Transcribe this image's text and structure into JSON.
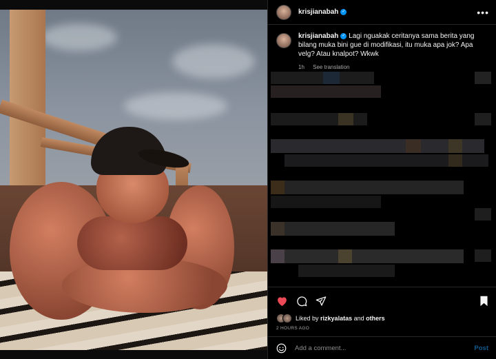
{
  "post": {
    "username": "krisjianabah",
    "verified_icon": "verified-badge-icon",
    "more_icon": "more-options-icon",
    "photo_alt": "Shirtless man in a black cap smiling, resting on a pillow"
  },
  "caption": {
    "username": "krisjianabah",
    "text": "Lagi nguakak ceritanya sama berita yang bilang muka bini gue di modifikasi, itu muka apa jok? Apa velg? Atau knalpot? Wkwk",
    "time": "1h",
    "see_translation": "See translation"
  },
  "actions": {
    "like_icon": "heart-filled-icon",
    "comment_icon": "comment-icon",
    "share_icon": "share-icon",
    "save_icon": "bookmark-icon",
    "liked_by_prefix": "Liked by",
    "liked_by_user": "rizkyalatas",
    "liked_by_and": "and",
    "liked_by_others": "others",
    "timestamp": "2 HOURS AGO"
  },
  "comment_box": {
    "emoji_icon": "emoji-icon",
    "placeholder": "Add a comment...",
    "post_label": "Post"
  },
  "colors": {
    "background": "#000000",
    "like": "#ed4956",
    "verified": "#0095f6",
    "post_button_disabled": "#115b8e",
    "muted_text": "#a8a8a8"
  }
}
